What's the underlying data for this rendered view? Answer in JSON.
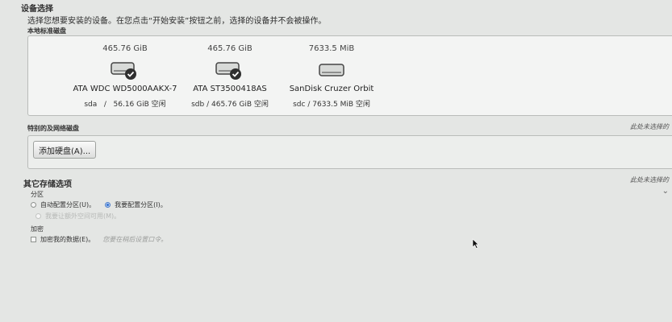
{
  "header": {
    "title": "设备选择",
    "subtitle": "选择您想要安装的设备。在您点击“开始安装”按钮之前，选择的设备并不会被操作。"
  },
  "local_disks": {
    "label": "本地标准磁盘",
    "disks": [
      {
        "size": "465.76 GiB",
        "name": "ATA WDC WD5000AAKX-7",
        "dev": "sda",
        "sep": "/",
        "free": "56.16 GiB 空闲",
        "selected": true
      },
      {
        "size": "465.76 GiB",
        "name": "ATA ST3500418AS",
        "dev": "sdb",
        "sep": "/",
        "free": "465.76 GiB 空闲",
        "selected": true
      },
      {
        "size": "7633.5 MiB",
        "name": "SanDisk Cruzer Orbit",
        "dev": "sdc",
        "sep": "/",
        "free": "7633.5 MiB 空闲",
        "selected": false
      }
    ]
  },
  "special_disks": {
    "label": "特别的及网络磁盘",
    "note": "此处未选择的",
    "add_button": "添加硬盘(A)..."
  },
  "other_storage": {
    "title": "其它存储选项",
    "note": "此处未选择的",
    "partition": {
      "label": "分区",
      "auto": "自动配置分区(U)。",
      "manual": "我要配置分区(I)。",
      "extra": "我要让额外空间可用(M)。"
    },
    "encryption": {
      "label": "加密",
      "option": "加密我的数据(E)。",
      "hint": "您要在稍后设置口令。"
    }
  },
  "colors": {
    "background": "#e4e6e4",
    "box": "#f3f4f3",
    "radio_selected": "#3a78d6"
  }
}
